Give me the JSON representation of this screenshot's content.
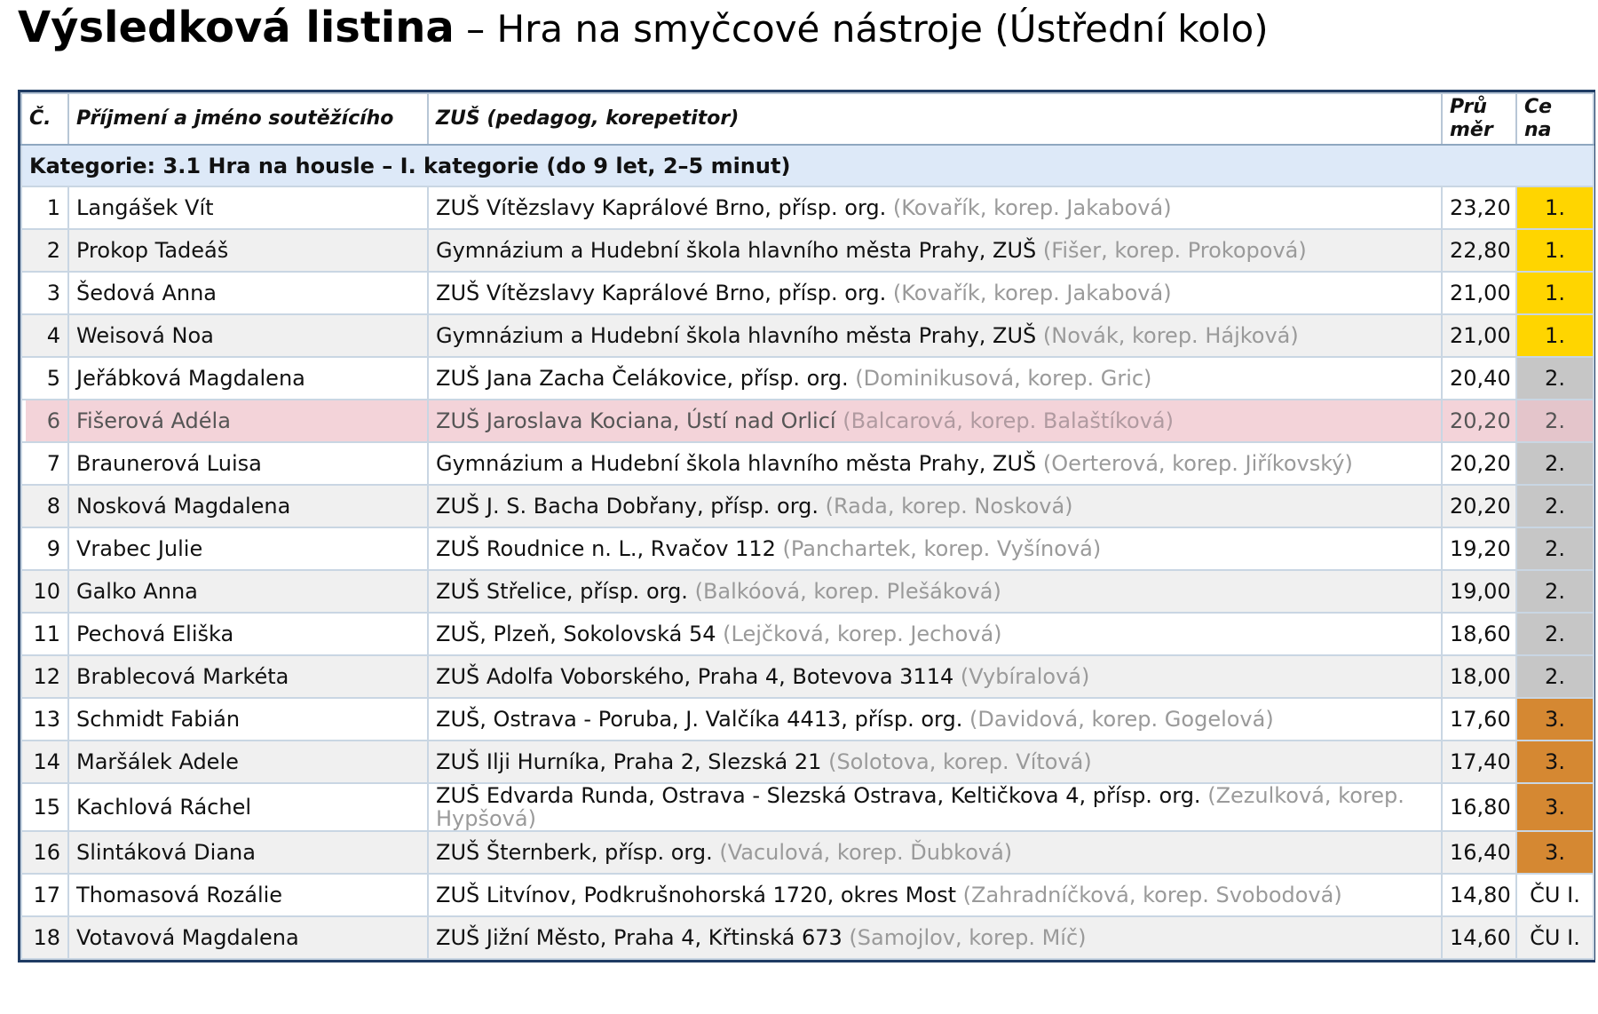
{
  "title": {
    "main": "Výsledková listina",
    "sub": " – Hra na smyčcové nástroje (Ústřední kolo)"
  },
  "table": {
    "headers": {
      "num": "Č.",
      "name": "Příjmení a jméno soutěžícího",
      "school": "ZUŠ (pedagog, korepetitor)",
      "avg": "Prů měr",
      "prize": "Ce na"
    },
    "category": "Kategorie: 3.1 Hra na housle – I. kategorie (do 9 let, 2–5 minut)",
    "rows": [
      {
        "num": "1",
        "name": "Langášek Vít",
        "school": "ZUŠ Vítězslavy Kaprálové Brno, přísp. org.",
        "teacher": "(Kovařík, korep. Jakabová)",
        "avg": "23,20",
        "prize": "1."
      },
      {
        "num": "2",
        "name": "Prokop Tadeáš",
        "school": "Gymnázium a Hudební škola hlavního města Prahy, ZUŠ",
        "teacher": "(Fišer, korep. Prokopová)",
        "avg": "22,80",
        "prize": "1."
      },
      {
        "num": "3",
        "name": "Šedová Anna",
        "school": "ZUŠ Vítězslavy Kaprálové Brno, přísp. org.",
        "teacher": "(Kovařík, korep. Jakabová)",
        "avg": "21,00",
        "prize": "1."
      },
      {
        "num": "4",
        "name": "Weisová Noa",
        "school": "Gymnázium a Hudební škola hlavního města Prahy, ZUŠ",
        "teacher": "(Novák, korep. Hájková)",
        "avg": "21,00",
        "prize": "1."
      },
      {
        "num": "5",
        "name": "Jeřábková Magdalena",
        "school": "ZUŠ Jana Zacha Čelákovice, přísp. org.",
        "teacher": "(Dominikusová, korep. Gric)",
        "avg": "20,40",
        "prize": "2."
      },
      {
        "num": "6",
        "name": "Fišerová Adéla",
        "school": "ZUŠ Jaroslava Kociana, Ústí nad Orlicí",
        "teacher": "(Balcarová, korep. Balaštíková)",
        "avg": "20,20",
        "prize": "2."
      },
      {
        "num": "7",
        "name": "Braunerová Luisa",
        "school": "Gymnázium a Hudební škola hlavního města Prahy, ZUŠ",
        "teacher": "(Oerterová, korep. Jiříkovský)",
        "avg": "20,20",
        "prize": "2."
      },
      {
        "num": "8",
        "name": "Nosková Magdalena",
        "school": "ZUŠ J. S. Bacha Dobřany, přísp. org.",
        "teacher": "(Rada, korep. Nosková)",
        "avg": "20,20",
        "prize": "2."
      },
      {
        "num": "9",
        "name": "Vrabec Julie",
        "school": "ZUŠ Roudnice n. L., Rvačov 112",
        "teacher": "(Panchartek, korep. Vyšínová)",
        "avg": "19,20",
        "prize": "2."
      },
      {
        "num": "10",
        "name": "Galko Anna",
        "school": "ZUŠ Střelice, přísp. org.",
        "teacher": "(Balkóová, korep. Plešáková)",
        "avg": "19,00",
        "prize": "2."
      },
      {
        "num": "11",
        "name": "Pechová Eliška",
        "school": "ZUŠ, Plzeň, Sokolovská 54",
        "teacher": "(Lejčková, korep. Jechová)",
        "avg": "18,60",
        "prize": "2."
      },
      {
        "num": "12",
        "name": "Brablecová Markéta",
        "school": "ZUŠ Adolfa Voborského, Praha 4, Botevova 3114",
        "teacher": "(Vybíralová)",
        "avg": "18,00",
        "prize": "2."
      },
      {
        "num": "13",
        "name": "Schmidt Fabián",
        "school": "ZUŠ, Ostrava - Poruba, J. Valčíka 4413, přísp. org.",
        "teacher": "(Davidová, korep. Gogelová)",
        "avg": "17,60",
        "prize": "3."
      },
      {
        "num": "14",
        "name": "Maršálek Adele",
        "school": "ZUŠ Ilji Hurníka, Praha 2, Slezská 21",
        "teacher": "(Solotova, korep. Vítová)",
        "avg": "17,40",
        "prize": "3."
      },
      {
        "num": "15",
        "name": "Kachlová Ráchel",
        "school": "ZUŠ Edvarda Runda, Ostrava - Slezská Ostrava, Keltičkova 4, přísp. org.",
        "teacher": "(Zezulková, korep. Hypšová)",
        "avg": "16,80",
        "prize": "3."
      },
      {
        "num": "16",
        "name": "Slintáková Diana",
        "school": "ZUŠ Šternberk, přísp. org.",
        "teacher": "(Vaculová, korep. Ďubková)",
        "avg": "16,40",
        "prize": "3."
      },
      {
        "num": "17",
        "name": "Thomasová Rozálie",
        "school": "ZUŠ Litvínov, Podkrušnohorská 1720, okres Most",
        "teacher": "(Zahradníčková, korep. Svobodová)",
        "avg": "14,80",
        "prize": "ČU I."
      },
      {
        "num": "18",
        "name": "Votavová Magdalena",
        "school": "ZUŠ Jižní Město, Praha 4, Křtinská 673",
        "teacher": "(Samojlov, korep. Míč)",
        "avg": "14,60",
        "prize": "ČU I."
      }
    ]
  },
  "colors": {
    "gold": "#ffd500",
    "silver": "#c6c6c6",
    "bronze": "#d58832",
    "category_bg": "#dde9f8",
    "highlight_bg": "#f3d3d9",
    "border": "#1f3b63"
  }
}
